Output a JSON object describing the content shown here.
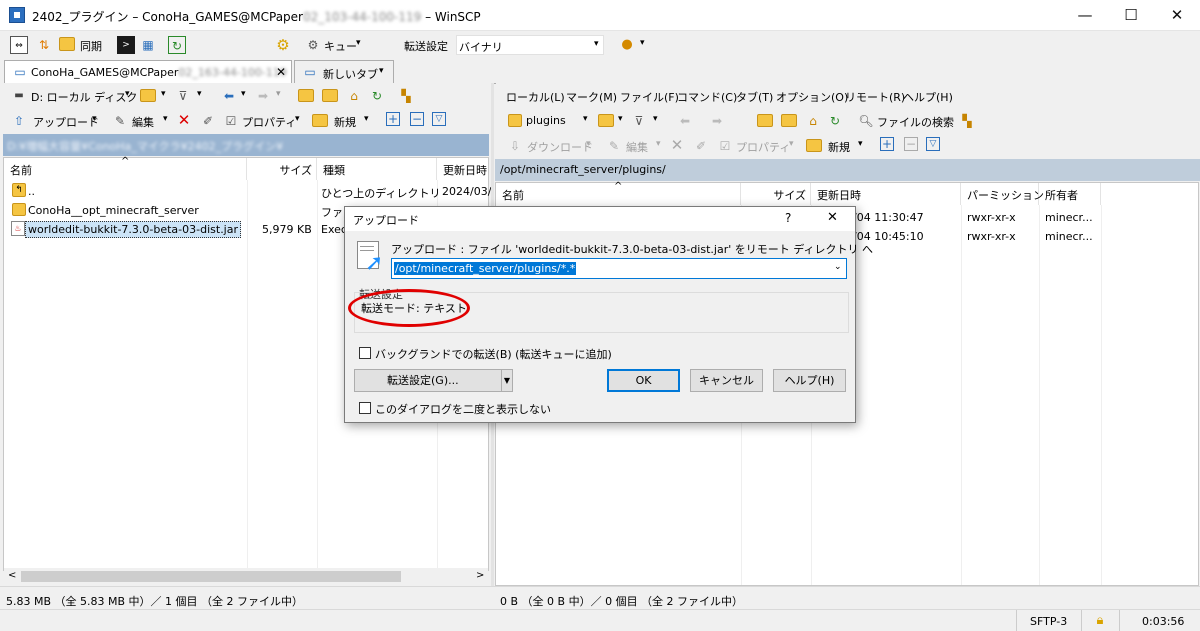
{
  "window": {
    "title_prefix": "2402_プラグイン – ConoHa_GAMES@MCPaper",
    "title_masked": "02_103-44-100-119",
    "title_suffix": " – WinSCP",
    "min": "—",
    "max": "☐",
    "close": "✕"
  },
  "toolbar": {
    "sync": "同期",
    "queue": "キュー",
    "transfer_label": "転送設定",
    "transfer_value": "バイナリ"
  },
  "tabs": {
    "session": "ConoHa_GAMES@MCPaper",
    "session_masked": "02_163-44-100-119",
    "new_tab": "新しいタブ"
  },
  "left": {
    "drive": "D: ローカル ディスク",
    "upload": "アップロード",
    "edit": "編集",
    "properties": "プロパティ",
    "new": "新規",
    "path_masked": "D:¥増幅大容量¥ConoHa_マイクラ¥2402_プラグイン¥",
    "columns": {
      "name": "名前",
      "size": "サイズ",
      "type": "種類",
      "date": "更新日時"
    },
    "rows": [
      {
        "name": "..",
        "size": "",
        "type": "ひとつ上のディレクトリ",
        "date": "2024/03/"
      },
      {
        "name": "ConoHa__opt_minecraft_server",
        "size": "",
        "type": "ファイル フォルダー",
        "date": ""
      },
      {
        "name": "worldedit-bukkit-7.3.0-beta-03-dist.jar",
        "size": "5,979 KB",
        "type": "Exec",
        "date": ""
      }
    ],
    "status": "5.83 MB （全 5.83 MB 中）／ 1 個目 （全 2 ファイル中）"
  },
  "right": {
    "menu": [
      "ローカル(L)",
      "マーク(M)",
      "ファイル(F)",
      "コマンド(C)",
      "タブ(T)",
      "オプション(O)",
      "リモート(R)",
      "ヘルプ(H)"
    ],
    "dir": "plugins",
    "find": "ファイルの検索",
    "download": "ダウンロード",
    "edit": "編集",
    "properties": "プロパティ",
    "new": "新規",
    "path": "/opt/minecraft_server/plugins/",
    "columns": {
      "name": "名前",
      "size": "サイズ",
      "date": "更新日時",
      "perm": "パーミッション",
      "owner": "所有者"
    },
    "rows": [
      {
        "date": "/04 11:30:47",
        "perm": "rwxr-xr-x",
        "owner": "minecr..."
      },
      {
        "date": "/04 10:45:10",
        "perm": "rwxr-xr-x",
        "owner": "minecr..."
      }
    ],
    "status": "0 B （全 0 B 中）／ 0 個目 （全 2 ファイル中）",
    "protocol": "SFTP-3",
    "elapsed": "0:03:56"
  },
  "dialog": {
    "title": "アップロード",
    "help_q": "?",
    "close": "✕",
    "message": "アップロード : ファイル 'worldedit-bukkit-7.3.0-beta-03-dist.jar' をリモート ディレクトリ へ",
    "target": "/opt/minecraft_server/plugins/*.*",
    "group_label": "転送設定",
    "transfer_mode": "転送モード: テキスト",
    "background": "バックグランドでの転送(B) (転送キューに追加)",
    "settings_btn": "転送設定(G)...",
    "ok": "OK",
    "cancel": "キャンセル",
    "help": "ヘルプ(H)",
    "no_show": "このダイアログを二度と表示しない",
    "highlight_color": "#e00000"
  }
}
